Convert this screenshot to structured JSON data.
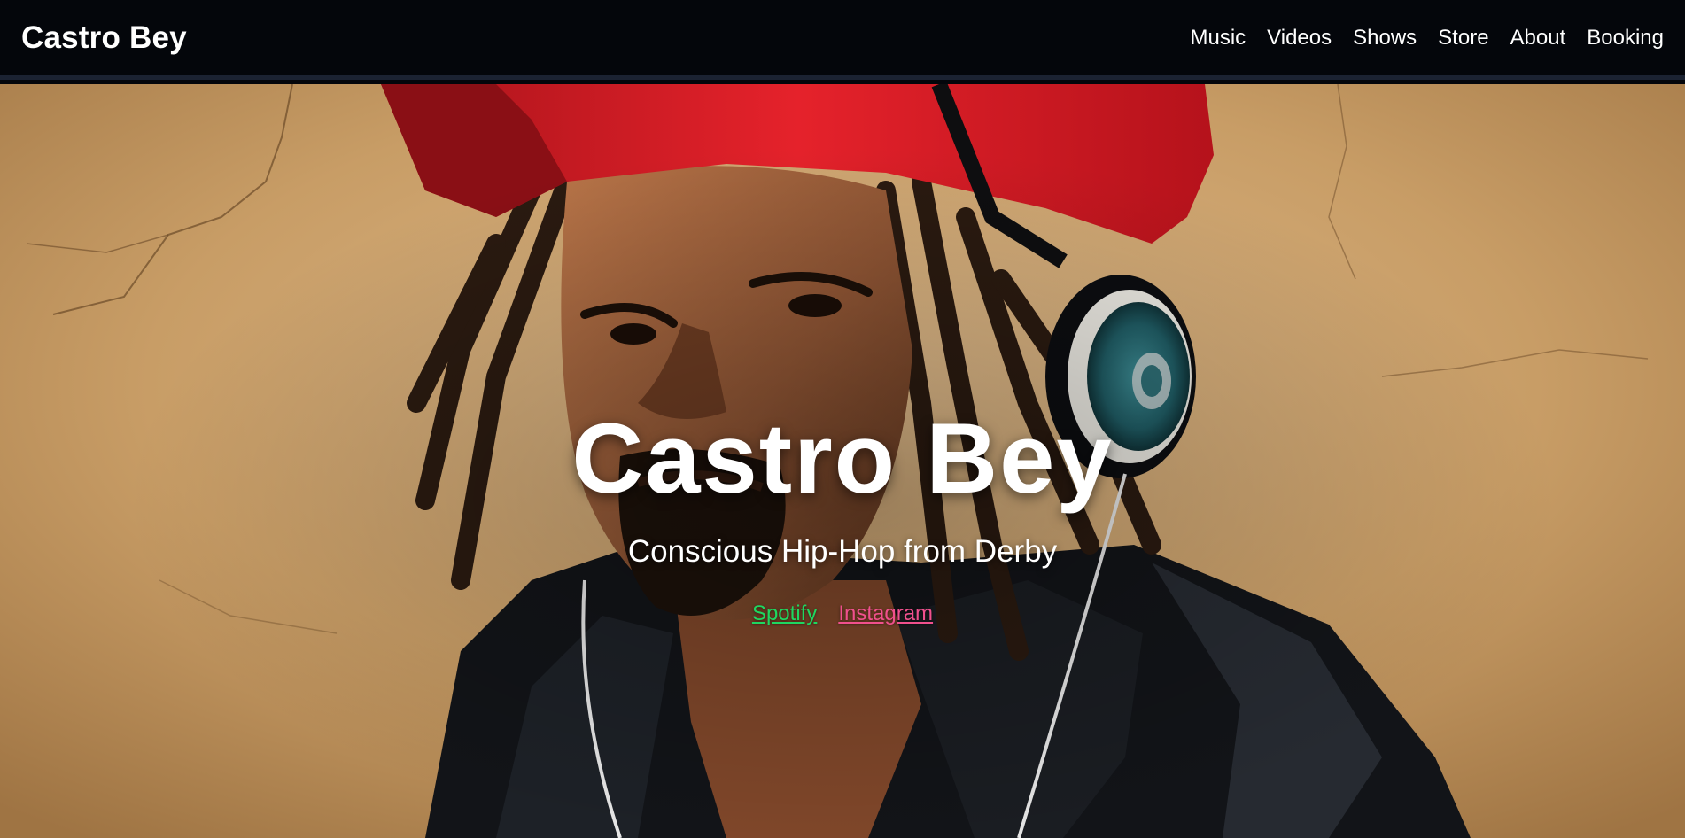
{
  "nav": {
    "brand": "Castro Bey",
    "items": [
      {
        "label": "Music"
      },
      {
        "label": "Videos"
      },
      {
        "label": "Shows"
      },
      {
        "label": "Store"
      },
      {
        "label": "About"
      },
      {
        "label": "Booking"
      }
    ]
  },
  "hero": {
    "title": "Castro Bey",
    "tagline": "Conscious Hip-Hop from Derby",
    "links": [
      {
        "label": "Spotify",
        "color": "#1ed760"
      },
      {
        "label": "Instagram",
        "color": "#f0508d"
      }
    ]
  },
  "colors": {
    "nav_bg": "#04060b",
    "nav_border": "#1b2232",
    "text": "#ffffff",
    "wall": "#c59a62"
  }
}
